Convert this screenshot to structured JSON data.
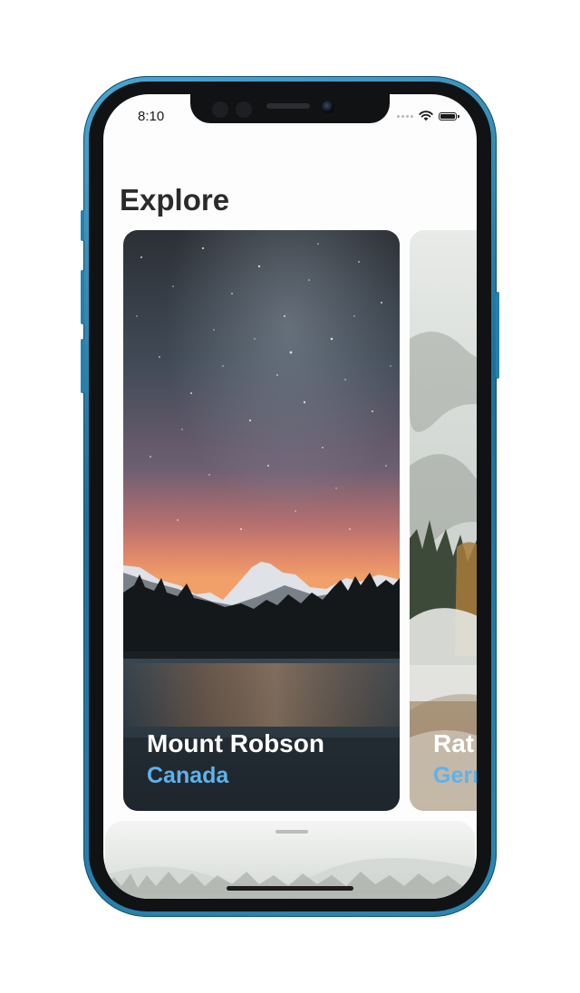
{
  "status_bar": {
    "time": "8:10"
  },
  "page": {
    "title": "Explore"
  },
  "cards": [
    {
      "title": "Mount Robson",
      "subtitle": "Canada"
    },
    {
      "title": "Rat",
      "subtitle": "Gerr"
    }
  ],
  "colors": {
    "accent": "#5fb2e8",
    "title_text": "#2b2b2b",
    "frame": "#2c87b4"
  },
  "icons": [
    "signal-dots-icon",
    "wifi-icon",
    "battery-icon"
  ]
}
